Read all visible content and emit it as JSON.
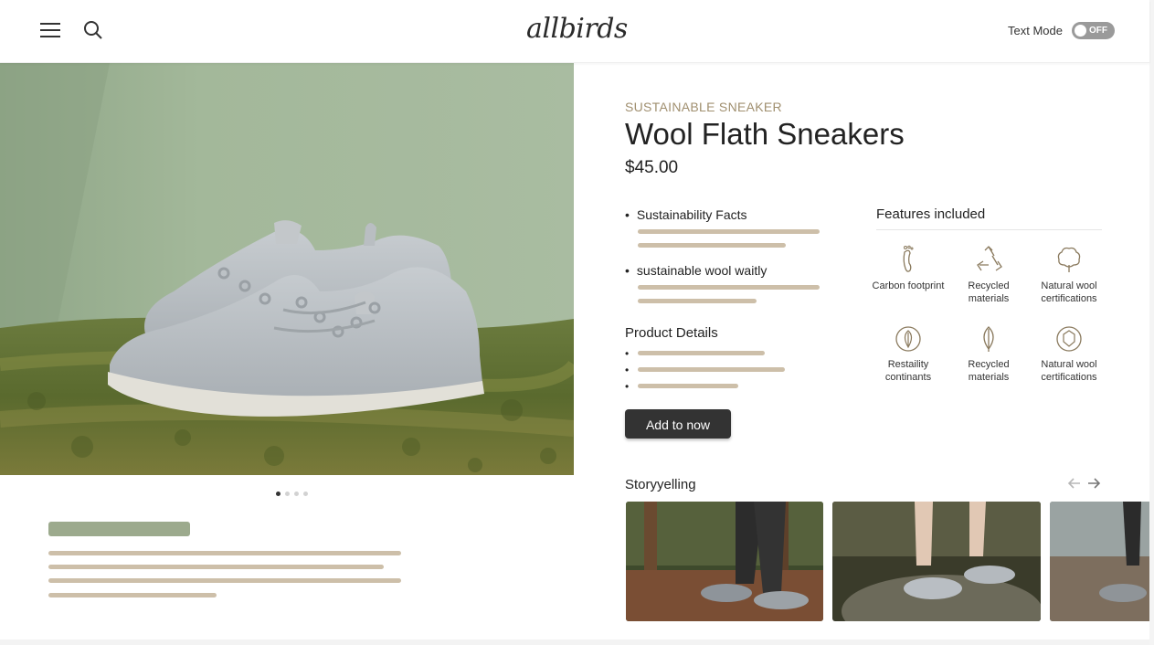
{
  "header": {
    "logo": "allbirds",
    "text_mode_label": "Text Mode",
    "toggle_state": "OFF",
    "icons": [
      "hamburger-menu-icon",
      "search-icon"
    ]
  },
  "hero": {
    "carousel_dots": 4,
    "active_dot": 1
  },
  "product": {
    "eyebrow": "SUSTAINABLE SNEAKER",
    "title": "Wool Flath Sneakers",
    "price": "$45.00",
    "bullets": [
      {
        "label": "Sustainability Facts"
      },
      {
        "label": "sustainable wool waitly"
      }
    ],
    "details_heading": "Product Details",
    "cta": "Add to now"
  },
  "features": {
    "heading": "Features included",
    "items": [
      {
        "label": "Carbon footprint",
        "icon": "footprint-icon"
      },
      {
        "label": "Recycled materials",
        "icon": "recycle-icon"
      },
      {
        "label": "Natural wool certifications",
        "icon": "cotton-flower-icon"
      },
      {
        "label": "Restaility continants",
        "icon": "leaf-badge-icon"
      },
      {
        "label": "Recycled materials",
        "icon": "leaf-icon"
      },
      {
        "label": "Natural wool certifications",
        "icon": "certification-badge-icon"
      }
    ]
  },
  "story": {
    "heading": "Storyyelling",
    "icons": [
      "arrow-left-icon",
      "arrow-right-icon"
    ]
  },
  "colors": {
    "accent_text": "#a08f6f",
    "placeholder_bar": "#cdbfa9",
    "placeholder_title": "#9caa8d",
    "button": "#333333"
  }
}
